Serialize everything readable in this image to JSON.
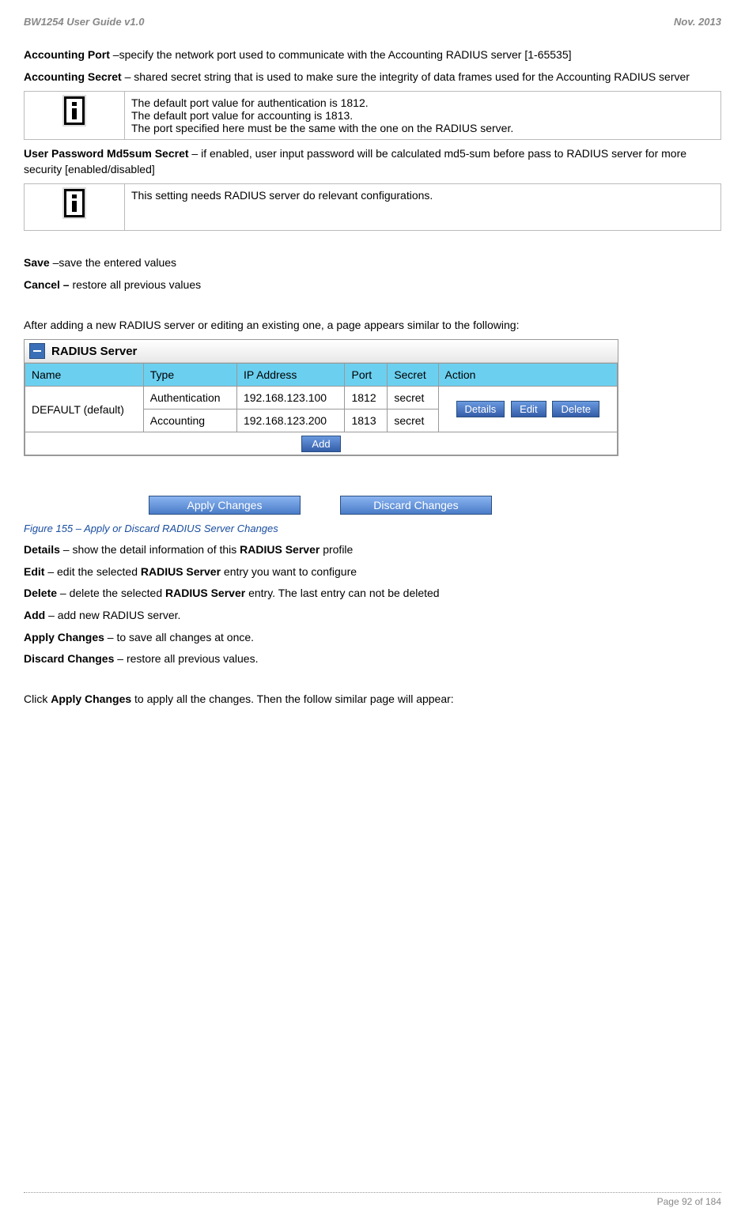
{
  "header": {
    "left": "BW1254 User Guide v1.0",
    "right": "Nov.  2013"
  },
  "intro": {
    "accounting_port_label": "Accounting Port",
    "accounting_port_text": " –specify the network port used to communicate with the Accounting RADIUS server [1-65535]",
    "accounting_secret_label": "Accounting Secret",
    "accounting_secret_text": " – shared secret string that is used to make sure the integrity of data frames used for the Accounting RADIUS server"
  },
  "note1": {
    "line1": "The default port value for authentication is 1812.",
    "line2": "The default port value for accounting is 1813.",
    "line3": "The port specified here must be the same with the one on the RADIUS server."
  },
  "md5": {
    "label": "User Password Md5sum Secret",
    "text": " – if enabled, user input password will be calculated md5-sum before pass to RADIUS server for more security [enabled/disabled]"
  },
  "note2": {
    "line1": "This setting needs RADIUS server do relevant configurations."
  },
  "save": {
    "label": "Save",
    "text": " –save the entered values"
  },
  "cancel": {
    "label": "Cancel –",
    "text": " restore all previous values"
  },
  "after_text": "After adding a new RADIUS server or editing an existing one, a page appears similar to the following:",
  "radius_panel": {
    "title": "RADIUS Server",
    "columns": {
      "name": "Name",
      "type": "Type",
      "ip": "IP Address",
      "port": "Port",
      "secret": "Secret",
      "action": "Action"
    },
    "row_name": "DEFAULT (default)",
    "rows": [
      {
        "type": "Authentication",
        "ip": "192.168.123.100",
        "port": "1812",
        "secret": "secret"
      },
      {
        "type": "Accounting",
        "ip": "192.168.123.200",
        "port": "1813",
        "secret": "secret"
      }
    ],
    "actions": {
      "details": "Details",
      "edit": "Edit",
      "delete": "Delete"
    },
    "add": "Add",
    "apply": "Apply Changes",
    "discard": "Discard Changes"
  },
  "caption": "Figure 155 – Apply or Discard RADIUS Server Changes",
  "definitions": {
    "details_label": "Details",
    "details_text": " – show the detail information of this ",
    "details_bold2": "RADIUS Server",
    "details_text2": " profile",
    "edit_label": "Edit",
    "edit_text": " – edit the selected ",
    "edit_bold2": "RADIUS Server",
    "edit_text2": " entry you want to configure",
    "delete_label": "Delete",
    "delete_text": " – delete the selected ",
    "delete_bold2": "RADIUS Server",
    "delete_text2": " entry. The last entry can not be deleted",
    "add_label": "Add",
    "add_text": " – add new RADIUS server.",
    "apply_label": "Apply Changes",
    "apply_text": " – to save all changes at once.",
    "discard_label": "Discard Changes",
    "discard_text": " – restore all previous values."
  },
  "closing": {
    "pre": "Click ",
    "bold": "Apply Changes",
    "post": " to apply all the changes. Then the follow similar page will appear:"
  },
  "footer": {
    "page": "Page 92 of 184"
  }
}
